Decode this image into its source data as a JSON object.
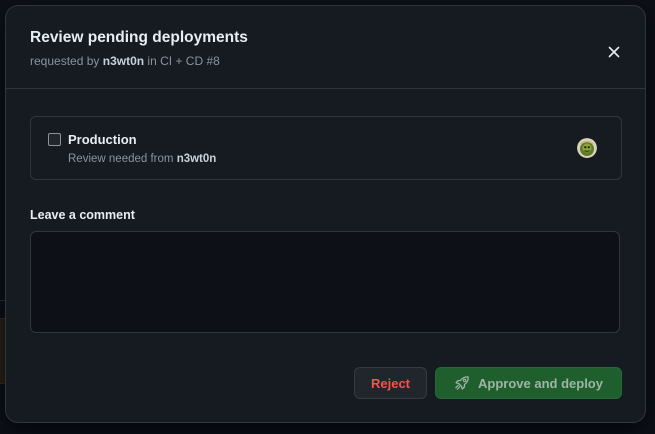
{
  "dialog": {
    "title": "Review pending deployments",
    "subtitle_prefix": "requested by",
    "requester": "n3wt0n",
    "subtitle_in": "in",
    "workflow": "CI + CD #8",
    "close_icon": "close-icon"
  },
  "environment": {
    "name": "Production",
    "checked": false,
    "review_prefix": "Review needed from",
    "reviewer": "n3wt0n",
    "avatar_icon": "avatar"
  },
  "comment": {
    "label": "Leave a comment",
    "value": "",
    "placeholder": ""
  },
  "actions": {
    "reject_label": "Reject",
    "approve_label": "Approve and deploy",
    "approve_icon": "rocket-icon"
  },
  "colors": {
    "reject_text": "#f85149",
    "approve_bg": "#1f5f2e"
  }
}
